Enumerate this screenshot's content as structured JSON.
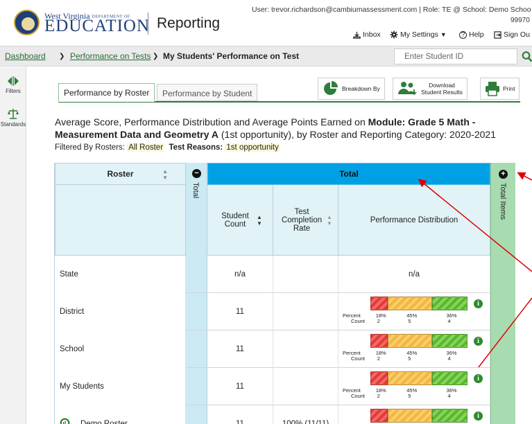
{
  "header": {
    "brand_top": "West Virginia",
    "brand_dept": "DEPARTMENT OF",
    "brand_main": "EDUCATION",
    "app_name": "Reporting",
    "user_info": "User: trevor.richardson@cambiumassessment.com  |  Role: TE @ School: Demo Schoo",
    "user_info_2": "99970",
    "inbox": "Inbox",
    "settings": "My Settings",
    "help": "Help",
    "signout": "Sign Ou"
  },
  "breadcrumb": {
    "items": [
      "Dashboard",
      "Performance on Tests",
      "My Students' Performance on Test"
    ],
    "search_placeholder": "Enter Student ID"
  },
  "rail": {
    "filters": "Filters",
    "standards": "Standards"
  },
  "tabs": [
    {
      "label": "Performance by Roster",
      "active": true
    },
    {
      "label": "Performance by Student",
      "active": false
    }
  ],
  "toolbar": {
    "breakdown": "Breakdown By",
    "download_1": "Download",
    "download_2": "Student Results",
    "print": "Print"
  },
  "description": {
    "part1": "Average Score, Performance Distribution and Average Points Earned on ",
    "bold": "Module: Grade 5 Math - Measurement Data and Geometry A",
    "part2": " (1st opportunity), by Roster and Reporting Category: 2020-2021",
    "filter_rosters_label": "Filtered By Rosters:",
    "filter_rosters_value": "All Roster",
    "filter_reasons_label": "Test Reasons:",
    "filter_reasons_value": "1st opportunity"
  },
  "table": {
    "roster_header": "Roster",
    "total_collapsed": "Total",
    "total_header": "Total",
    "total_items": "Total Items",
    "col_student_count": "Student Count",
    "col_completion": "Test Completion Rate",
    "col_distribution": "Performance Distribution",
    "percent_label": "Percent",
    "count_label": "Count",
    "rows": [
      {
        "name": "State",
        "count": "n/a",
        "rate": "",
        "dist_text": "n/a",
        "dist": null
      },
      {
        "name": "District",
        "count": "11",
        "rate": "",
        "dist_text": "",
        "dist": {
          "pct": [
            "18%",
            "45%",
            "36%"
          ],
          "cnt": [
            "2",
            "5",
            "4"
          ],
          "fr": [
            0.18,
            0.45,
            0.36
          ]
        }
      },
      {
        "name": "School",
        "count": "11",
        "rate": "",
        "dist_text": "",
        "dist": {
          "pct": [
            "18%",
            "45%",
            "36%"
          ],
          "cnt": [
            "2",
            "5",
            "4"
          ],
          "fr": [
            0.18,
            0.45,
            0.36
          ]
        }
      },
      {
        "name": "My Students",
        "count": "11",
        "rate": "",
        "dist_text": "",
        "dist": {
          "pct": [
            "18%",
            "45%",
            "36%"
          ],
          "cnt": [
            "2",
            "5",
            "4"
          ],
          "fr": [
            0.18,
            0.45,
            0.36
          ]
        }
      },
      {
        "name": "Demo Roster",
        "count": "11",
        "rate": "100% (11/11)",
        "dist_text": "",
        "link": true,
        "dist": {
          "pct": [
            "18%",
            "45%",
            "36%"
          ],
          "cnt": [
            "2",
            "5",
            "4"
          ],
          "fr": [
            0.18,
            0.45,
            0.36
          ]
        }
      }
    ]
  },
  "colors": {
    "accent_green": "#2f7d3a",
    "total_blue": "#00a1e4",
    "annotation_red": "#e00000"
  }
}
